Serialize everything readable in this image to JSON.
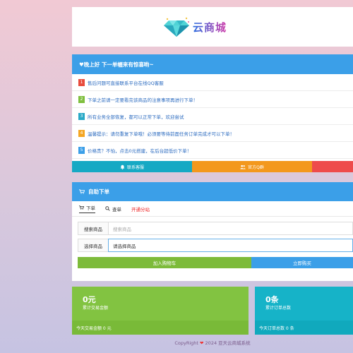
{
  "logo": {
    "text": "云商城"
  },
  "notice": {
    "title": "♥晚上好 下一单幄来有惊喜哟~",
    "items": [
      {
        "num": "1",
        "text": "售后问题可直接联系平台在线QQ客服"
      },
      {
        "num": "2",
        "text": "下单之前请一定要看完该商品的注意事项再进行下单！"
      },
      {
        "num": "3",
        "text": "所有业务全部恢复，都可以正常下单，欢迎尝试"
      },
      {
        "num": "4",
        "text": "温馨提示：请勿重复下单哦！必须要等待前面任务订单完成才可以下单！"
      },
      {
        "num": "5",
        "text": "价格贵？不怕，点击0元搭建，在后台超低价下单！"
      }
    ],
    "buttons": {
      "service": "联系客服",
      "group": "官方Q群"
    }
  },
  "order": {
    "title": "自助下单",
    "tabs": {
      "buy": "下单",
      "query": "查单",
      "branch": "开通分站"
    },
    "search": {
      "label": "搜索商品",
      "placeholder": "搜索商品"
    },
    "select": {
      "label": "选择商品",
      "value": "请选择商品"
    },
    "cart": "加入购物车",
    "buy_now": "立即购买"
  },
  "stats": {
    "amount": {
      "value": "0元",
      "desc": "累计交易金额",
      "today": "今天交易金额 0 元"
    },
    "orders": {
      "value": "0条",
      "desc": "累计订单总数",
      "today": "今天订单总数 0 条"
    }
  },
  "footer": {
    "pre": "CopyRight",
    "post": "2024 亚天云商城系统"
  },
  "colors": {
    "primary": "#3b9fe8",
    "green": "#82c341",
    "cyan": "#16b3c8",
    "orange": "#f3981d",
    "red": "#ee4b4b"
  }
}
